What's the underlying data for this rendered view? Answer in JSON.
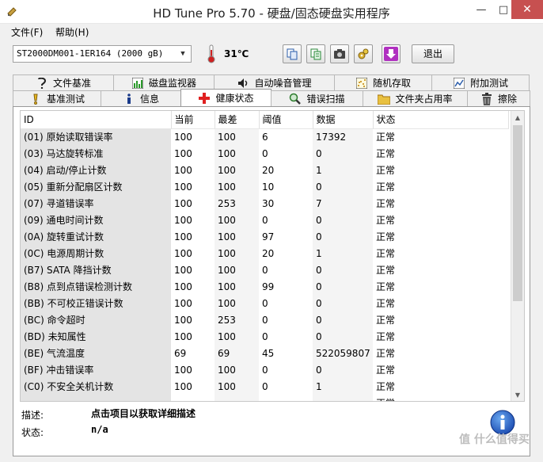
{
  "window": {
    "title": "HD Tune Pro 5.70 - 硬盘/固态硬盘实用程序",
    "minimize": "—",
    "maximize": "□",
    "close": "✕"
  },
  "menu": {
    "file": "文件(F)",
    "help": "帮助(H)"
  },
  "toolbar": {
    "drive": "ST2000DM001-1ER164 (2000 gB)",
    "temperature": "31℃",
    "exit_label": "退出",
    "icons": [
      "copy-icon",
      "copy-text-icon",
      "camera-icon",
      "gear-icon",
      "download-icon"
    ]
  },
  "tabs_row1": [
    {
      "label": "文件基准",
      "icon": "file-benchmark-icon"
    },
    {
      "label": "磁盘监视器",
      "icon": "disk-monitor-icon"
    },
    {
      "label": "自动噪音管理",
      "icon": "speaker-icon"
    },
    {
      "label": "随机存取",
      "icon": "random-access-icon"
    },
    {
      "label": "附加测试",
      "icon": "extra-tests-icon"
    }
  ],
  "tabs_row2": [
    {
      "label": "基准测试",
      "icon": "benchmark-icon"
    },
    {
      "label": "信息",
      "icon": "info-icon"
    },
    {
      "label": "健康状态",
      "icon": "health-cross-icon",
      "active": true
    },
    {
      "label": "错误扫描",
      "icon": "magnifier-icon"
    },
    {
      "label": "文件夹占用率",
      "icon": "folder-icon"
    },
    {
      "label": "擦除",
      "icon": "trash-icon"
    }
  ],
  "table": {
    "headers": [
      "ID",
      "当前",
      "最差",
      "阈值",
      "数据",
      "状态"
    ],
    "rows": [
      [
        "(01) 原始读取错误率",
        "100",
        "100",
        "6",
        "17392",
        "正常"
      ],
      [
        "(03) 马达旋转标准",
        "100",
        "100",
        "0",
        "0",
        "正常"
      ],
      [
        "(04) 启动/停止计数",
        "100",
        "100",
        "20",
        "1",
        "正常"
      ],
      [
        "(05) 重新分配扇区计数",
        "100",
        "100",
        "10",
        "0",
        "正常"
      ],
      [
        "(07) 寻道错误率",
        "100",
        "253",
        "30",
        "7",
        "正常"
      ],
      [
        "(09) 通电时间计数",
        "100",
        "100",
        "0",
        "0",
        "正常"
      ],
      [
        "(0A) 旋转重试计数",
        "100",
        "100",
        "97",
        "0",
        "正常"
      ],
      [
        "(0C) 电源周期计数",
        "100",
        "100",
        "20",
        "1",
        "正常"
      ],
      [
        "(B7) SATA 降挡计数",
        "100",
        "100",
        "0",
        "0",
        "正常"
      ],
      [
        "(B8) 点到点错误检测计数",
        "100",
        "100",
        "99",
        "0",
        "正常"
      ],
      [
        "(BB) 不可校正错误计数",
        "100",
        "100",
        "0",
        "0",
        "正常"
      ],
      [
        "(BC) 命令超时",
        "100",
        "253",
        "0",
        "0",
        "正常"
      ],
      [
        "(BD) 未知属性",
        "100",
        "100",
        "0",
        "0",
        "正常"
      ],
      [
        "(BE) 气流温度",
        "69",
        "69",
        "45",
        "522059807",
        "正常"
      ],
      [
        "(BF) 冲击错误率",
        "100",
        "100",
        "0",
        "0",
        "正常"
      ],
      [
        "(C0) 不安全关机计数",
        "100",
        "100",
        "0",
        "1",
        "正常"
      ],
      [
        "",
        "",
        "",
        "",
        "",
        "正常"
      ]
    ]
  },
  "details": {
    "desc_label": "描述:",
    "desc_text": "点击项目以获取详细描述",
    "state_label": "状态:",
    "state_text": "n/a"
  },
  "watermark": "值 什么值得买"
}
